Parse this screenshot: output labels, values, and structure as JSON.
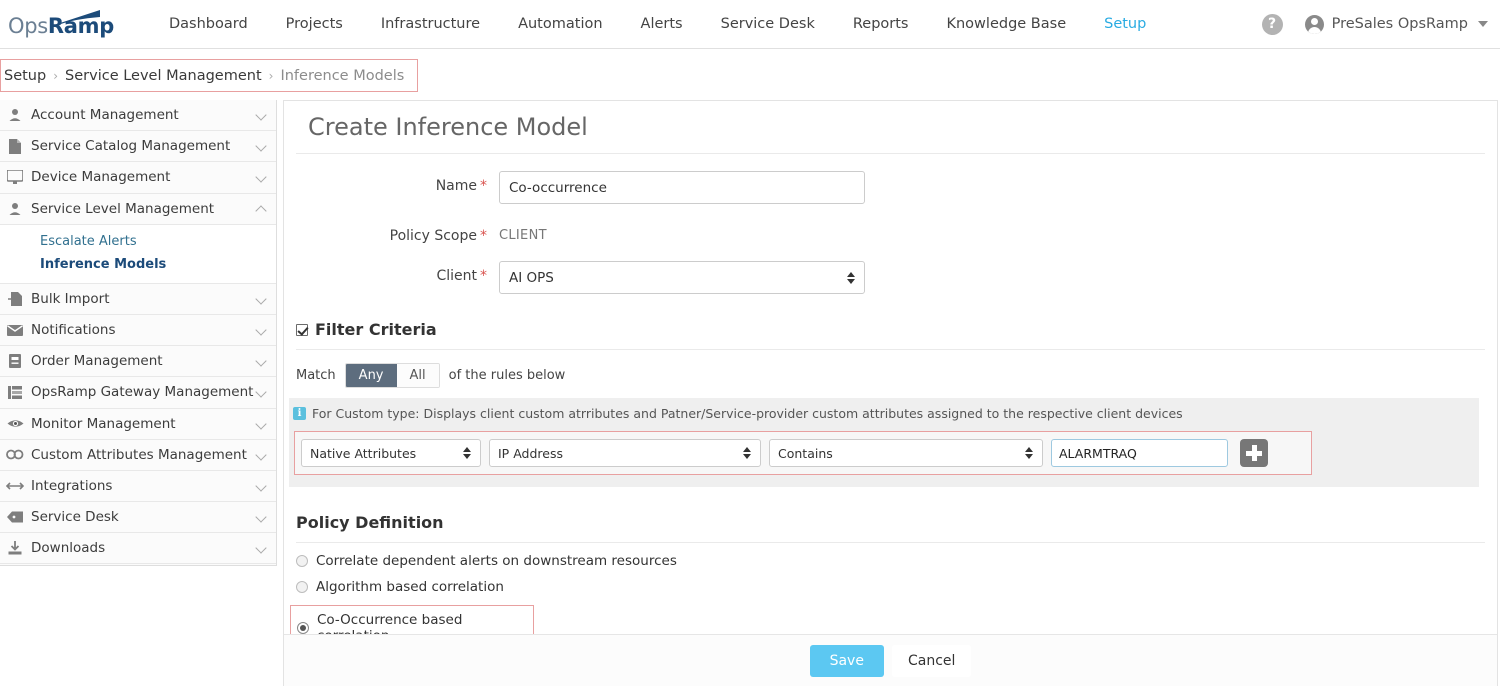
{
  "brand": {
    "logo_prefix": "Ops",
    "logo_suffix": "Ramp",
    "accent": "#29abe2"
  },
  "topnav": {
    "items": [
      {
        "label": "Dashboard",
        "active": false
      },
      {
        "label": "Projects",
        "active": false
      },
      {
        "label": "Infrastructure",
        "active": false
      },
      {
        "label": "Automation",
        "active": false
      },
      {
        "label": "Alerts",
        "active": false
      },
      {
        "label": "Service Desk",
        "active": false
      },
      {
        "label": "Reports",
        "active": false
      },
      {
        "label": "Knowledge Base",
        "active": false
      },
      {
        "label": "Setup",
        "active": true
      }
    ],
    "help_label": "?",
    "user_name": "PreSales OpsRamp"
  },
  "breadcrumb": {
    "root": "Setup",
    "sep": "›",
    "middle": "Service Level Management",
    "current": "Inference Models"
  },
  "sidebar": {
    "items": [
      {
        "label": "Account Management",
        "icon": "user-icon",
        "expanded": false
      },
      {
        "label": "Service Catalog Management",
        "icon": "document-icon",
        "expanded": false
      },
      {
        "label": "Device Management",
        "icon": "monitor-icon",
        "expanded": false
      },
      {
        "label": "Service Level Management",
        "icon": "user-icon",
        "expanded": true
      },
      {
        "label": "Bulk Import",
        "icon": "import-icon",
        "expanded": false
      },
      {
        "label": "Notifications",
        "icon": "envelope-icon",
        "expanded": false
      },
      {
        "label": "Order Management",
        "icon": "book-icon",
        "expanded": false
      },
      {
        "label": "OpsRamp Gateway Management",
        "icon": "gateway-icon",
        "expanded": false
      },
      {
        "label": "Monitor Management",
        "icon": "eye-icon",
        "expanded": false
      },
      {
        "label": "Custom Attributes Management",
        "icon": "link-icon",
        "expanded": false
      },
      {
        "label": "Integrations",
        "icon": "plug-icon",
        "expanded": false
      },
      {
        "label": "Service Desk",
        "icon": "tag-icon",
        "expanded": false
      },
      {
        "label": "Downloads",
        "icon": "download-icon",
        "expanded": false
      }
    ],
    "subitems": [
      {
        "label": "Escalate Alerts",
        "active": false
      },
      {
        "label": "Inference Models",
        "active": true
      }
    ]
  },
  "main": {
    "title": "Create Inference Model",
    "fields": {
      "name_label": "Name",
      "name_value": "Co-occurrence",
      "policy_scope_label": "Policy Scope",
      "policy_scope_value": "CLIENT",
      "client_label": "Client",
      "client_value": "AI OPS",
      "required_mark": "*"
    },
    "filter": {
      "section_title": "Filter Criteria",
      "checked": true,
      "match_label": "Match",
      "toggle_any": "Any",
      "toggle_all": "All",
      "match_suffix": "of the rules below",
      "selected_match": "Any",
      "info_icon_label": "i",
      "info_text": "For Custom type: Displays client custom atrributes and Patner/Service-provider custom attributes assigned to the respective client devices",
      "rule": {
        "attribute_type": "Native Attributes",
        "attribute_name": "IP Address",
        "operator": "Contains",
        "value": "ALARMTRAQ",
        "add_button": "+"
      }
    },
    "policy": {
      "section_title": "Policy Definition",
      "options": [
        {
          "label": "Correlate dependent alerts on downstream resources",
          "selected": false
        },
        {
          "label": "Algorithm based correlation",
          "selected": false
        },
        {
          "label": "Co-Occurrence based correlation",
          "selected": true
        }
      ]
    },
    "footer": {
      "save_label": "Save",
      "cancel_label": "Cancel"
    }
  }
}
